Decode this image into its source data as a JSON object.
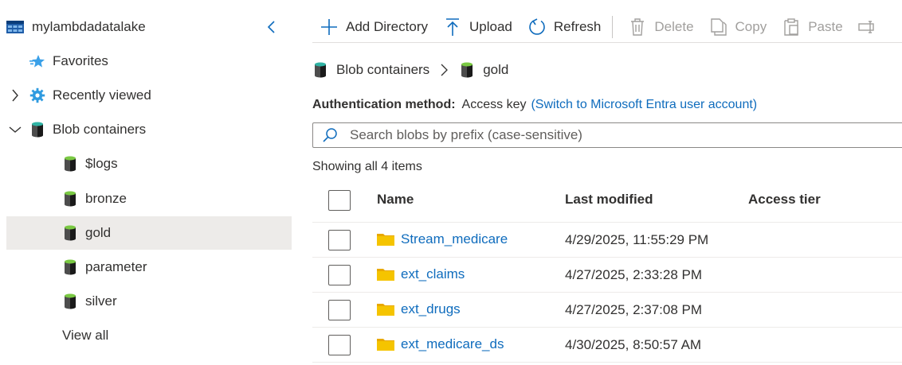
{
  "sidebar": {
    "account": "mylambdadatalake",
    "favorites": "Favorites",
    "recently_viewed": "Recently viewed",
    "blob_containers": "Blob containers",
    "containers": [
      "$logs",
      "bronze",
      "gold",
      "parameter",
      "silver"
    ],
    "selected": "gold",
    "view_all": "View all"
  },
  "toolbar": {
    "add_directory": "Add Directory",
    "upload": "Upload",
    "refresh": "Refresh",
    "delete": "Delete",
    "copy": "Copy",
    "paste": "Paste"
  },
  "breadcrumb": {
    "root": "Blob containers",
    "current": "gold"
  },
  "auth": {
    "label": "Authentication method:",
    "value": "Access key",
    "link": "(Switch to Microsoft Entra user account)"
  },
  "search": {
    "placeholder": "Search blobs by prefix (case-sensitive)"
  },
  "showing": "Showing all 4 items",
  "table": {
    "columns": [
      "Name",
      "Last modified",
      "Access tier"
    ],
    "rows": [
      {
        "name": "Stream_medicare",
        "modified": "4/29/2025, 11:55:29 PM",
        "tier": ""
      },
      {
        "name": "ext_claims",
        "modified": "4/27/2025, 2:33:28 PM",
        "tier": ""
      },
      {
        "name": "ext_drugs",
        "modified": "4/27/2025, 2:37:08 PM",
        "tier": ""
      },
      {
        "name": "ext_medicare_ds",
        "modified": "4/30/2025, 8:50:57 AM",
        "tier": ""
      }
    ]
  },
  "colors": {
    "accent": "#0f6cbd",
    "selected_bg": "#edebe9",
    "folder": "#f5c400",
    "container_teal": "#30b3a4"
  }
}
